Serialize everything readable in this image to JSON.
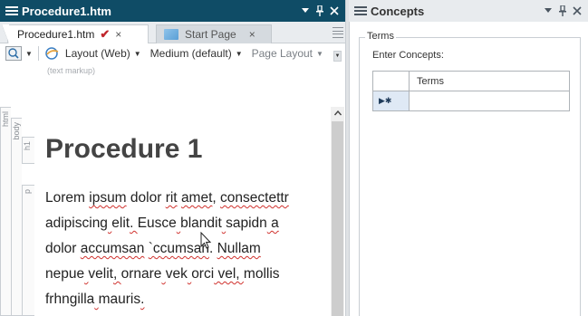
{
  "left_panel": {
    "title": "Procedure1.htm",
    "tabs": [
      {
        "label": "Procedure1.htm",
        "active": true,
        "status_glyph": "✔",
        "close_glyph": "×"
      },
      {
        "label": "Start Page",
        "active": false,
        "close_glyph": "×"
      }
    ],
    "toolbar": {
      "layout_label": "Layout (Web)",
      "size_label": "Medium (default)",
      "page_layout_label": "Page Layout",
      "hint": "(text markup)"
    },
    "structure_tags": [
      "html",
      "body",
      "h1",
      "p"
    ],
    "document": {
      "heading": "Procedure 1",
      "paragraph_lines": [
        [
          "Lorem ",
          "ipsum",
          " dolor ",
          "rit",
          " ",
          "amet",
          ", ",
          "consectettr"
        ],
        [
          "adipiscing",
          " ",
          "elit",
          ". ",
          "Eusce",
          " ",
          "blandit",
          " ",
          "sapidn",
          " a"
        ],
        [
          "dolor ",
          "accumsan",
          " ",
          "`ccumsan",
          ". ",
          "Nullam"
        ],
        [
          "nepue",
          " ",
          "velit",
          ", ",
          "ornare",
          " ",
          "vek",
          " ",
          "orci",
          " vel, ",
          "mollis"
        ],
        [
          "frhngilla",
          " ",
          "mauris",
          "."
        ]
      ]
    }
  },
  "right_panel": {
    "title": "Concepts",
    "group_label": "Terms",
    "prompt": "Enter Concepts:",
    "grid": {
      "column_header": "Terms",
      "new_row_marker": "▶✱"
    }
  },
  "colors": {
    "title_bar": "#0f4c66",
    "spell_error": "#d0312d",
    "check_mark": "#c0272d"
  }
}
